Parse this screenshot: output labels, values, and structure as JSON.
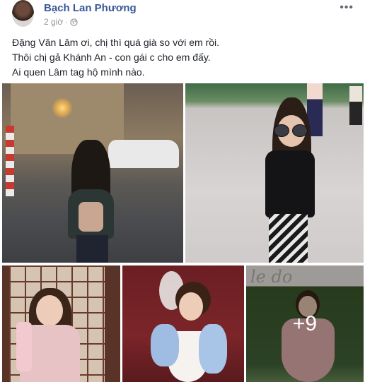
{
  "post": {
    "author": "Bạch Lan Phương",
    "time": "2 giờ",
    "more_icon": "more-horizontal-icon",
    "privacy_icon": "globe-icon",
    "message_lines": [
      "Đặng Văn Lâm ơi, chị thì quá già so với em rồi.",
      "Thôi chị gả Khánh An - con gái c cho em đấy.",
      "Ai quen Lâm tag hộ mình nào."
    ]
  },
  "photos": {
    "more_count": "+9"
  },
  "colors": {
    "author_link": "#385898",
    "meta_text": "#90949c",
    "body_text": "#1d2129"
  }
}
